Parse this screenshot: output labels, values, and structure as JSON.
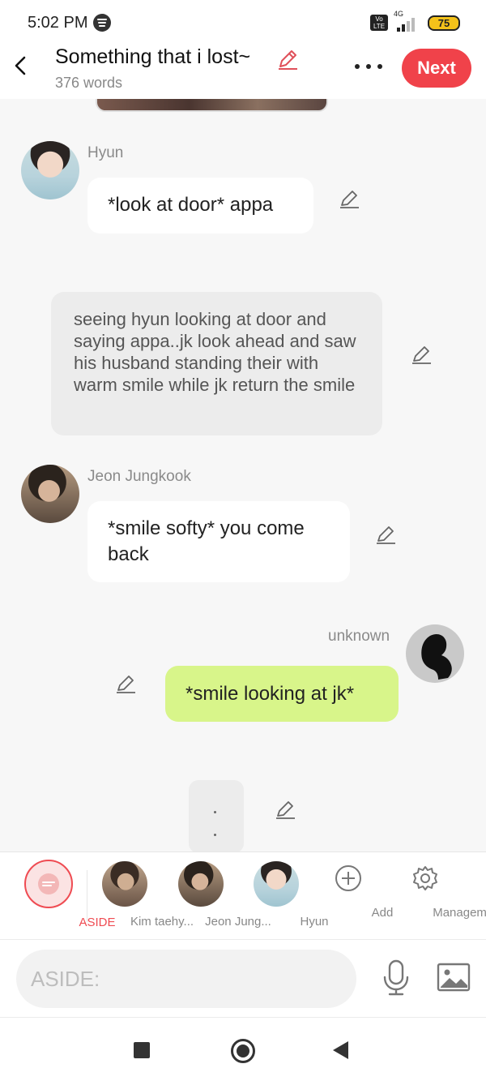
{
  "status_bar": {
    "time": "5:02 PM",
    "network_type": "4G",
    "volte_label": "Vo LTE",
    "battery": "75",
    "icons": [
      "spotify-icon",
      "volte-icon",
      "signal-icon",
      "battery-icon"
    ]
  },
  "header": {
    "title": "Something that i lost~",
    "word_count": "376 words",
    "next_label": "Next",
    "colors": {
      "accent": "#f0424a",
      "pencil": "#e0505a"
    }
  },
  "messages": [
    {
      "speaker": "Hyun",
      "text": "*look at door* appa",
      "side": "left"
    },
    {
      "type": "aside",
      "text": "seeing hyun looking at door and saying appa..jk look ahead and saw his husband standing their with warm smile while jk return the smile"
    },
    {
      "speaker": "Jeon Jungkook",
      "text": "*smile softy* you come back",
      "side": "left"
    },
    {
      "speaker": "unknown",
      "text": "*smile looking at jk*",
      "side": "right"
    }
  ],
  "character_bar": {
    "aside_label": "ASIDE",
    "characters": [
      {
        "name": "Kim taehy..."
      },
      {
        "name": "Jeon Jung..."
      },
      {
        "name": "Hyun"
      }
    ],
    "add_label": "Add",
    "management_label": "Management",
    "colors": {
      "aside_active": "#ef4b52"
    }
  },
  "input": {
    "placeholder": "ASIDE:"
  },
  "colors": {
    "user_bubble": "#d8f58a",
    "aside_bubble": "#ececec",
    "background": "#f7f7f7"
  }
}
